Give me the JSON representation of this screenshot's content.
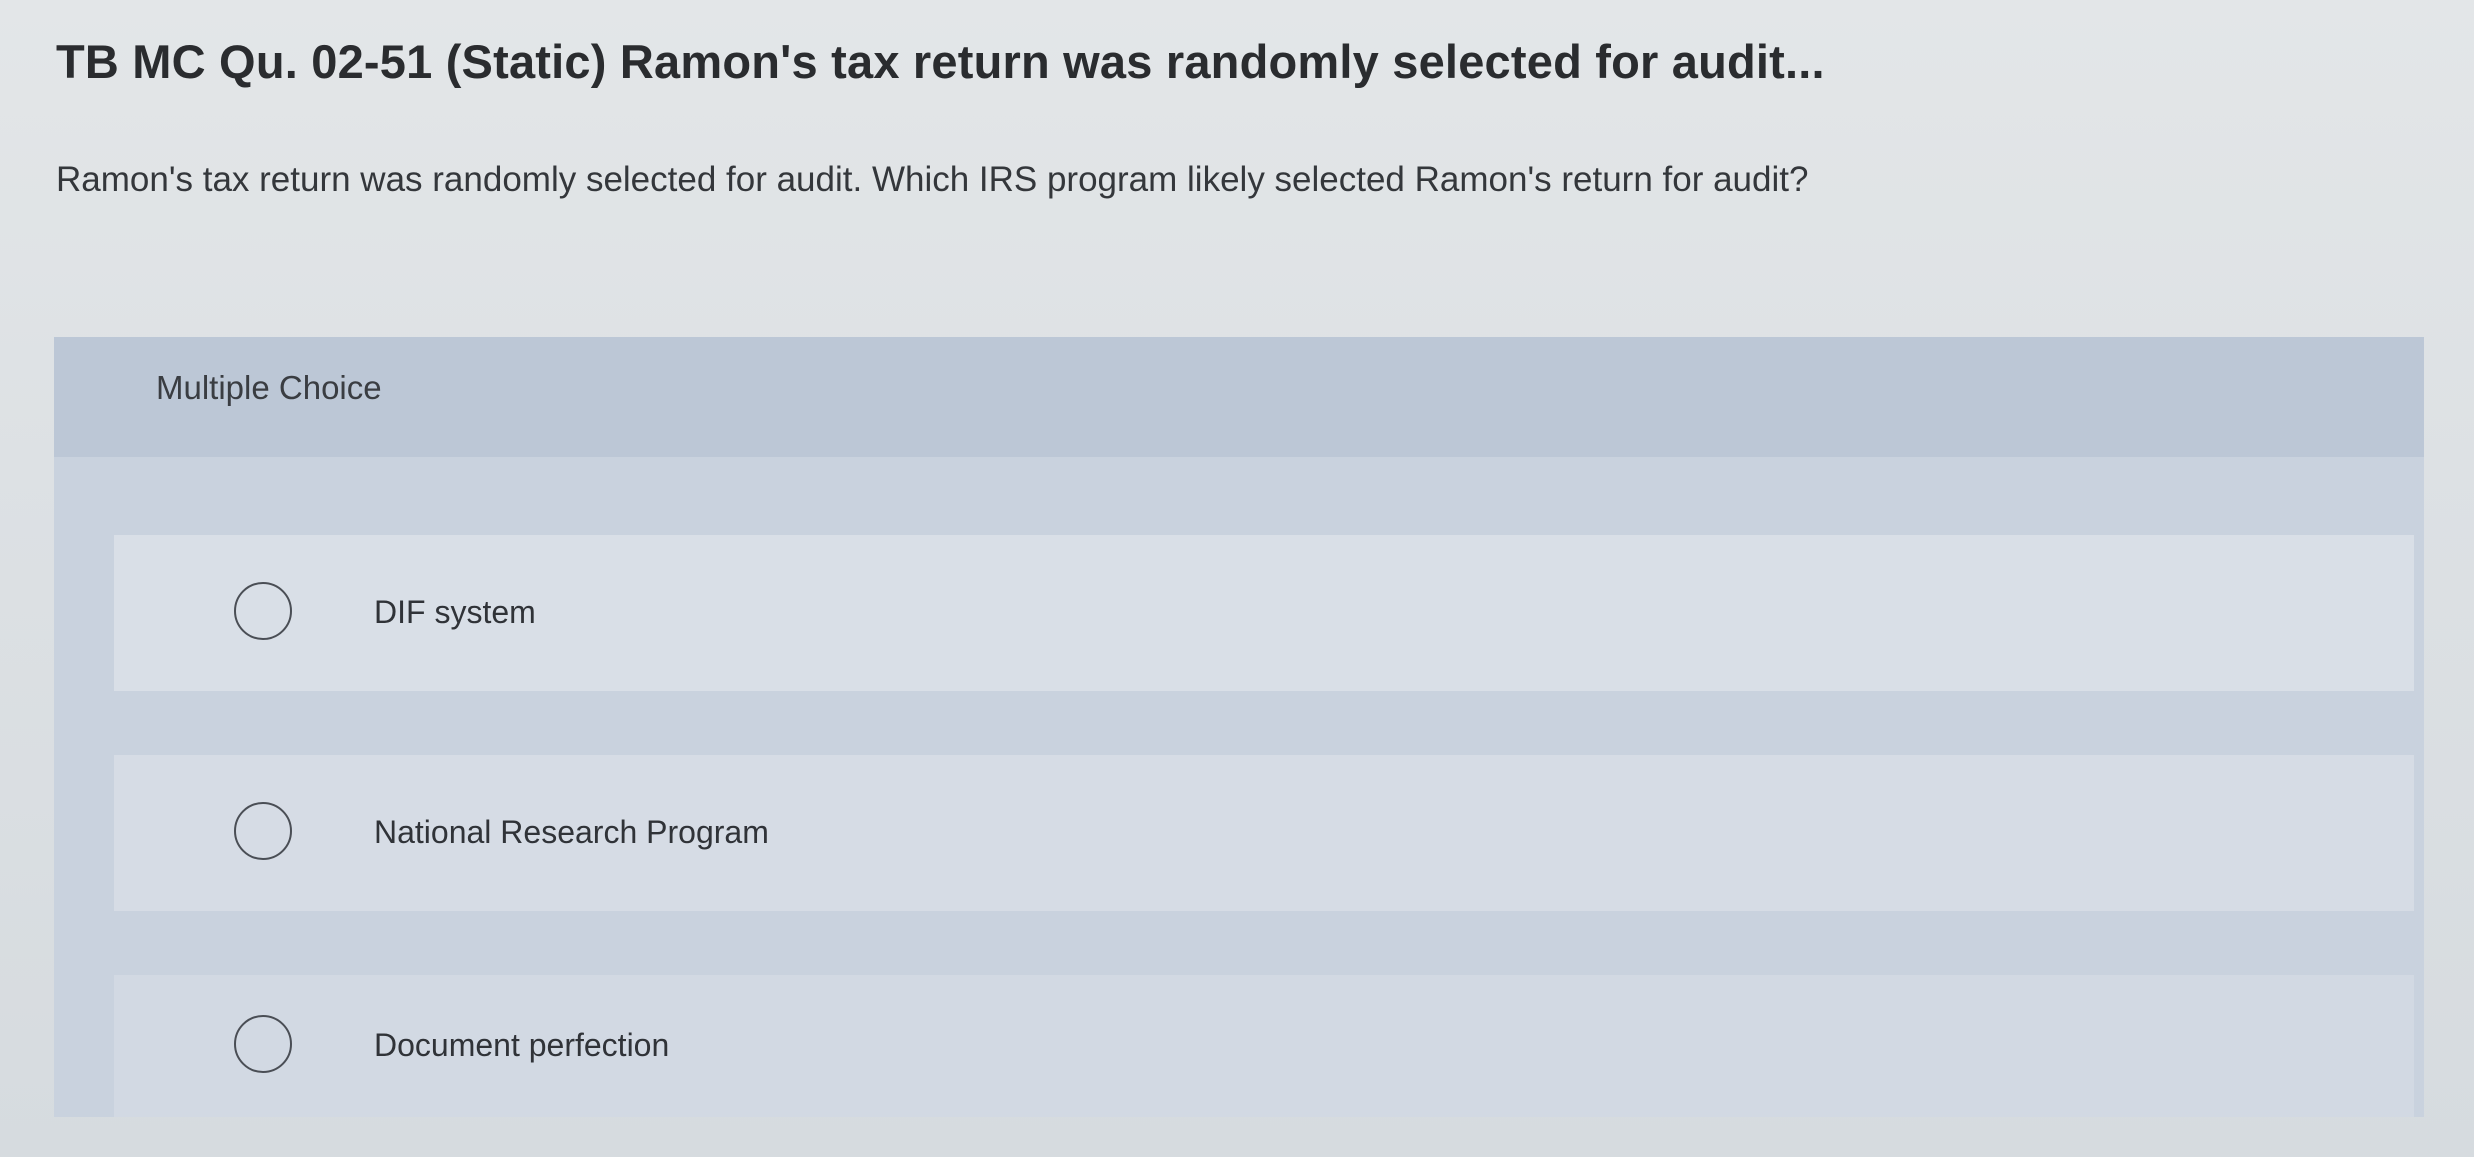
{
  "question": {
    "title": "TB MC Qu. 02-51 (Static) Ramon's tax return was randomly selected for audit...",
    "prompt": "Ramon's tax return was randomly selected for audit. Which IRS program likely selected Ramon's return for audit?"
  },
  "multiple_choice": {
    "header": "Multiple Choice",
    "options": [
      {
        "label": "DIF system",
        "selected": false
      },
      {
        "label": "National Research Program",
        "selected": false
      },
      {
        "label": "Document perfection",
        "selected": false
      }
    ]
  }
}
